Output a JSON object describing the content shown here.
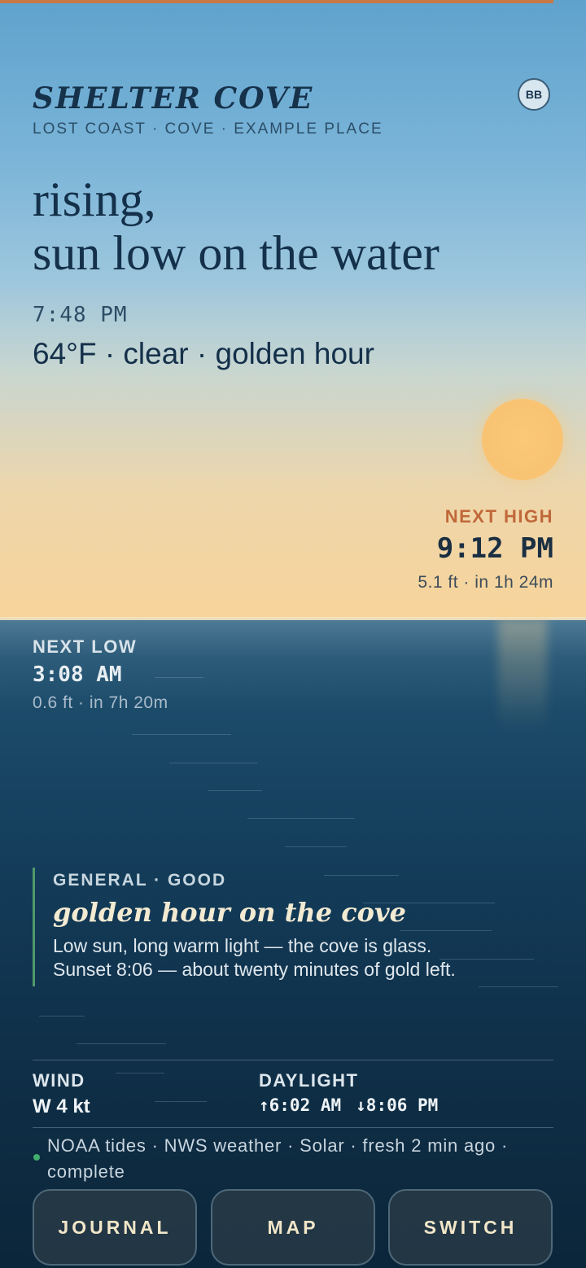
{
  "header": {
    "place_name": "SHELTER COVE",
    "place_subtitle": "LOST COAST · COVE · EXAMPLE PLACE",
    "avatar_initials": "BB"
  },
  "headline": {
    "line1": "rising,",
    "line2": "sun low on the water"
  },
  "now": {
    "time": "7:48 PM",
    "conditions": "64°F · clear · golden hour"
  },
  "next_high": {
    "label": "NEXT HIGH",
    "time": "9:12 PM",
    "detail": "5.1 ft · in 1h 24m"
  },
  "next_low": {
    "label": "NEXT LOW",
    "time": "3:08 AM",
    "detail": "0.6 ft · in 7h 20m"
  },
  "advisory": {
    "tag": "GENERAL · GOOD",
    "title": "golden hour on the cove",
    "line1": "Low sun, long warm light — the cove is glass.",
    "line2": "Sunset 8:06 — about twenty minutes of gold left."
  },
  "stats": {
    "wind_label": "WIND",
    "wind_value": "W 4 kt",
    "daylight_label": "DAYLIGHT",
    "sunrise": "↑6:02 AM",
    "sunset": "↓8:06 PM"
  },
  "footer": {
    "sources": "NOAA tides · NWS weather · Solar · fresh 2 min ago · complete"
  },
  "nav": {
    "journal": "JOURNAL",
    "map": "MAP",
    "switch": "SWITCH"
  },
  "colors": {
    "accent_orange": "#c0683a",
    "status_green": "#3fae6b",
    "sun": "#f8c473"
  }
}
